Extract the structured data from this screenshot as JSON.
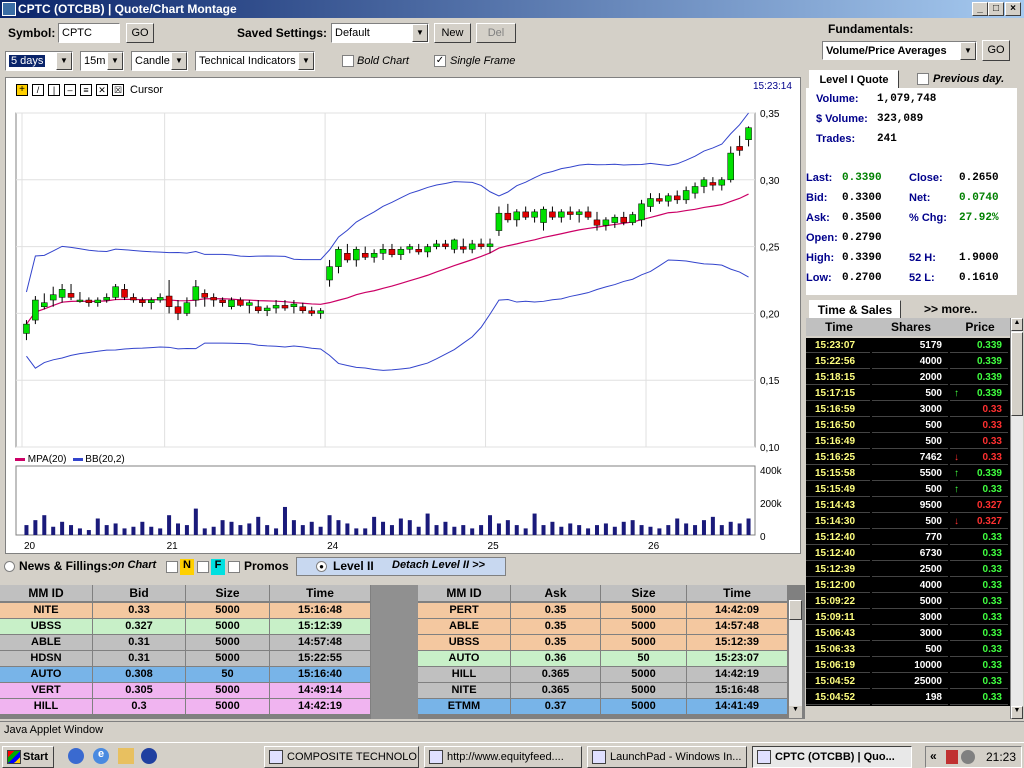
{
  "window": {
    "title": "CPTC (OTCBB)  |  Quote/Chart Montage"
  },
  "toolbar": {
    "symbol_label": "Symbol:",
    "symbol_value": "CPTC",
    "go_label": "GO",
    "saved_label": "Saved Settings:",
    "saved_value": "Default",
    "new_label": "New",
    "del_label": "Del",
    "period_value": "5 days",
    "interval_value": "15m",
    "type_value": "Candle",
    "indicators_value": "Technical Indicators",
    "bold_chart_label": "Bold Chart",
    "single_frame_label": "Single Frame",
    "bold_chart_checked": false,
    "single_frame_checked": true
  },
  "chart_tools": {
    "cursor_label": "Cursor",
    "time": "15:23:14"
  },
  "chart_data": {
    "type": "candlestick",
    "y_axis_price": [
      "0,35",
      "0,30",
      "0,25",
      "0,20",
      "0,15",
      "0,10"
    ],
    "ylim": [
      0.1,
      0.35
    ],
    "x_axis_labels": [
      "20",
      "21",
      "24",
      "25",
      "26"
    ],
    "volume_axis": [
      "400k",
      "200k",
      "0"
    ],
    "legend": [
      {
        "name": "MPA(20)",
        "color": "#cc0066"
      },
      {
        "name": "BB(20,2)",
        "color": "#3344cc"
      }
    ],
    "candles": [
      [
        0.185,
        0.195,
        0.18,
        0.192
      ],
      [
        0.195,
        0.213,
        0.192,
        0.21
      ],
      [
        0.205,
        0.215,
        0.203,
        0.208
      ],
      [
        0.21,
        0.22,
        0.205,
        0.214
      ],
      [
        0.212,
        0.222,
        0.208,
        0.218
      ],
      [
        0.215,
        0.222,
        0.21,
        0.212
      ],
      [
        0.21,
        0.216,
        0.208,
        0.21
      ],
      [
        0.21,
        0.212,
        0.205,
        0.208
      ],
      [
        0.208,
        0.212,
        0.205,
        0.21
      ],
      [
        0.21,
        0.215,
        0.208,
        0.212
      ],
      [
        0.212,
        0.222,
        0.21,
        0.22
      ],
      [
        0.218,
        0.222,
        0.21,
        0.212
      ],
      [
        0.212,
        0.215,
        0.208,
        0.21
      ],
      [
        0.21,
        0.212,
        0.205,
        0.208
      ],
      [
        0.208,
        0.212,
        0.203,
        0.21
      ],
      [
        0.21,
        0.215,
        0.208,
        0.212
      ],
      [
        0.213,
        0.225,
        0.2,
        0.205
      ],
      [
        0.205,
        0.21,
        0.195,
        0.2
      ],
      [
        0.2,
        0.212,
        0.198,
        0.208
      ],
      [
        0.21,
        0.225,
        0.205,
        0.22
      ],
      [
        0.215,
        0.218,
        0.205,
        0.212
      ],
      [
        0.212,
        0.215,
        0.205,
        0.21
      ],
      [
        0.21,
        0.212,
        0.205,
        0.208
      ],
      [
        0.205,
        0.212,
        0.203,
        0.21
      ],
      [
        0.21,
        0.212,
        0.205,
        0.206
      ],
      [
        0.206,
        0.21,
        0.2,
        0.208
      ],
      [
        0.205,
        0.21,
        0.2,
        0.202
      ],
      [
        0.202,
        0.206,
        0.198,
        0.204
      ],
      [
        0.204,
        0.21,
        0.2,
        0.206
      ],
      [
        0.206,
        0.21,
        0.202,
        0.204
      ],
      [
        0.205,
        0.21,
        0.2,
        0.207
      ],
      [
        0.205,
        0.208,
        0.2,
        0.202
      ],
      [
        0.202,
        0.205,
        0.198,
        0.2
      ],
      [
        0.2,
        0.204,
        0.196,
        0.202
      ],
      [
        0.225,
        0.24,
        0.22,
        0.235
      ],
      [
        0.235,
        0.25,
        0.23,
        0.248
      ],
      [
        0.245,
        0.252,
        0.238,
        0.24
      ],
      [
        0.24,
        0.25,
        0.235,
        0.248
      ],
      [
        0.245,
        0.25,
        0.24,
        0.242
      ],
      [
        0.242,
        0.248,
        0.238,
        0.245
      ],
      [
        0.245,
        0.252,
        0.24,
        0.248
      ],
      [
        0.248,
        0.252,
        0.242,
        0.244
      ],
      [
        0.244,
        0.25,
        0.24,
        0.248
      ],
      [
        0.248,
        0.252,
        0.245,
        0.25
      ],
      [
        0.248,
        0.252,
        0.244,
        0.246
      ],
      [
        0.246,
        0.252,
        0.242,
        0.25
      ],
      [
        0.25,
        0.255,
        0.248,
        0.252
      ],
      [
        0.252,
        0.255,
        0.248,
        0.25
      ],
      [
        0.248,
        0.256,
        0.245,
        0.255
      ],
      [
        0.25,
        0.256,
        0.245,
        0.248
      ],
      [
        0.248,
        0.255,
        0.245,
        0.252
      ],
      [
        0.252,
        0.256,
        0.248,
        0.25
      ],
      [
        0.25,
        0.256,
        0.245,
        0.252
      ],
      [
        0.262,
        0.28,
        0.258,
        0.275
      ],
      [
        0.275,
        0.282,
        0.268,
        0.27
      ],
      [
        0.27,
        0.278,
        0.265,
        0.276
      ],
      [
        0.276,
        0.28,
        0.27,
        0.272
      ],
      [
        0.272,
        0.278,
        0.268,
        0.276
      ],
      [
        0.268,
        0.28,
        0.262,
        0.278
      ],
      [
        0.276,
        0.28,
        0.27,
        0.272
      ],
      [
        0.272,
        0.278,
        0.268,
        0.276
      ],
      [
        0.276,
        0.28,
        0.27,
        0.274
      ],
      [
        0.274,
        0.278,
        0.268,
        0.276
      ],
      [
        0.276,
        0.28,
        0.27,
        0.272
      ],
      [
        0.27,
        0.276,
        0.262,
        0.266
      ],
      [
        0.266,
        0.272,
        0.262,
        0.27
      ],
      [
        0.268,
        0.274,
        0.264,
        0.272
      ],
      [
        0.272,
        0.276,
        0.266,
        0.268
      ],
      [
        0.268,
        0.276,
        0.266,
        0.274
      ],
      [
        0.27,
        0.285,
        0.265,
        0.282
      ],
      [
        0.28,
        0.29,
        0.276,
        0.286
      ],
      [
        0.286,
        0.29,
        0.282,
        0.284
      ],
      [
        0.284,
        0.29,
        0.28,
        0.288
      ],
      [
        0.288,
        0.292,
        0.282,
        0.285
      ],
      [
        0.285,
        0.295,
        0.282,
        0.292
      ],
      [
        0.29,
        0.298,
        0.286,
        0.295
      ],
      [
        0.295,
        0.302,
        0.29,
        0.3
      ],
      [
        0.298,
        0.302,
        0.292,
        0.296
      ],
      [
        0.296,
        0.302,
        0.292,
        0.3
      ],
      [
        0.3,
        0.325,
        0.298,
        0.32
      ],
      [
        0.325,
        0.333,
        0.318,
        0.322
      ],
      [
        0.33,
        0.34,
        0.325,
        0.339
      ]
    ],
    "volumes": [
      60,
      90,
      120,
      50,
      80,
      60,
      40,
      30,
      100,
      60,
      70,
      40,
      50,
      80,
      50,
      40,
      120,
      70,
      60,
      160,
      40,
      50,
      90,
      80,
      60,
      70,
      110,
      60,
      40,
      170,
      90,
      60,
      80,
      50,
      120,
      90,
      70,
      40,
      40,
      110,
      80,
      60,
      100,
      90,
      50,
      130,
      60,
      80,
      50,
      60,
      40,
      60,
      120,
      70,
      90,
      60,
      40,
      130,
      60,
      80,
      50,
      70,
      60,
      40,
      60,
      70,
      50,
      80,
      90,
      60,
      50,
      40,
      60,
      100,
      70,
      60,
      90,
      110,
      60,
      80,
      70,
      100
    ]
  },
  "fundamentals": {
    "label": "Fundamentals:",
    "select_value": "Volume/Price Averages",
    "go_label": "GO"
  },
  "level1": {
    "tab_label": "Level I Quote",
    "previous_day_label": "Previous day.",
    "volume_label": "Volume:",
    "volume": "1,079,748",
    "dvolume_label": "$ Volume:",
    "dvolume": "323,089",
    "trades_label": "Trades:",
    "trades": "241",
    "last_label": "Last:",
    "last": "0.3390",
    "close_label": "Close:",
    "close": "0.2650",
    "bid_label": "Bid:",
    "bid": "0.3300",
    "net_label": "Net:",
    "net": "0.0740",
    "ask_label": "Ask:",
    "ask": "0.3500",
    "chg_label": "% Chg:",
    "chg": "27.92%",
    "open_label": "Open:",
    "open": "0.2790",
    "high_label": "High:",
    "high": "0.3390",
    "h52_label": "52 H:",
    "h52": "1.9000",
    "low_label": "Low:",
    "low": "0.2700",
    "l52_label": "52 L:",
    "l52": "0.1610"
  },
  "time_sales": {
    "tab_label": "Time & Sales",
    "more_label": ">> more..",
    "headers": [
      "Time",
      "Shares",
      "Price"
    ],
    "rows": [
      [
        "15:23:07",
        "5179",
        "0.339",
        "up"
      ],
      [
        "15:22:56",
        "4000",
        "0.339",
        "up"
      ],
      [
        "15:18:15",
        "2000",
        "0.339",
        "up"
      ],
      [
        "15:17:15",
        "500",
        "0.339",
        "upa"
      ],
      [
        "15:16:59",
        "3000",
        "0.33",
        "dn"
      ],
      [
        "15:16:50",
        "500",
        "0.33",
        "dn"
      ],
      [
        "15:16:49",
        "500",
        "0.33",
        "dn"
      ],
      [
        "15:16:25",
        "7462",
        "0.33",
        "dna"
      ],
      [
        "15:15:58",
        "5500",
        "0.339",
        "upa"
      ],
      [
        "15:15:49",
        "500",
        "0.33",
        "upa"
      ],
      [
        "15:14:43",
        "9500",
        "0.327",
        "dn"
      ],
      [
        "15:14:30",
        "500",
        "0.327",
        "dna"
      ],
      [
        "15:12:40",
        "770",
        "0.33",
        "up"
      ],
      [
        "15:12:40",
        "6730",
        "0.33",
        "up"
      ],
      [
        "15:12:39",
        "2500",
        "0.33",
        "up"
      ],
      [
        "15:12:00",
        "4000",
        "0.33",
        "up"
      ],
      [
        "15:09:22",
        "5000",
        "0.33",
        "up"
      ],
      [
        "15:09:11",
        "3000",
        "0.33",
        "up"
      ],
      [
        "15:06:43",
        "3000",
        "0.33",
        "up"
      ],
      [
        "15:06:33",
        "500",
        "0.33",
        "up"
      ],
      [
        "15:06:19",
        "10000",
        "0.33",
        "up"
      ],
      [
        "15:04:52",
        "25000",
        "0.33",
        "up"
      ],
      [
        "15:04:52",
        "198",
        "0.33",
        "up"
      ]
    ]
  },
  "news_bar": {
    "news_label": "News & Fillings:",
    "on_chart": "on Chart",
    "n_label": "N",
    "f_label": "F",
    "promos_label": "Promos",
    "level2_label": "Level II",
    "detach_label": "Detach Level II >>"
  },
  "level2": {
    "bid_headers": [
      "MM ID",
      "Bid",
      "Size",
      "Time"
    ],
    "ask_headers": [
      "MM ID",
      "Ask",
      "Size",
      "Time"
    ],
    "bids": [
      [
        "NITE",
        "0.33",
        "5000",
        "15:16:48",
        "#f4c8a0"
      ],
      [
        "UBSS",
        "0.327",
        "5000",
        "15:12:39",
        "#c8f0c8"
      ],
      [
        "ABLE",
        "0.31",
        "5000",
        "14:57:48",
        "#c0c0c0"
      ],
      [
        "HDSN",
        "0.31",
        "5000",
        "15:22:55",
        "#c0c0c0"
      ],
      [
        "AUTO",
        "0.308",
        "50",
        "15:16:40",
        "#78b4e8"
      ],
      [
        "VERT",
        "0.305",
        "5000",
        "14:49:14",
        "#f0b4f0"
      ],
      [
        "HILL",
        "0.3",
        "5000",
        "14:42:19",
        "#f0b4f0"
      ]
    ],
    "asks": [
      [
        "PERT",
        "0.35",
        "5000",
        "14:42:09",
        "#f4c8a0"
      ],
      [
        "ABLE",
        "0.35",
        "5000",
        "14:57:48",
        "#f4c8a0"
      ],
      [
        "UBSS",
        "0.35",
        "5000",
        "15:12:39",
        "#f4c8a0"
      ],
      [
        "AUTO",
        "0.36",
        "50",
        "15:23:07",
        "#c8f0c8"
      ],
      [
        "HILL",
        "0.365",
        "5000",
        "14:42:19",
        "#c0c0c0"
      ],
      [
        "NITE",
        "0.365",
        "5000",
        "15:16:48",
        "#c0c0c0"
      ],
      [
        "ETMM",
        "0.37",
        "5000",
        "14:41:49",
        "#78b4e8"
      ]
    ]
  },
  "status": {
    "text": "Java Applet Window"
  },
  "taskbar": {
    "start_label": "Start",
    "tasks": [
      "COMPOSITE TECHNOLO...",
      "http://www.equityfeed....",
      "LaunchPad - Windows In...",
      "CPTC (OTCBB)  |  Quo..."
    ],
    "clock": "21:23",
    "chevron": "«"
  }
}
